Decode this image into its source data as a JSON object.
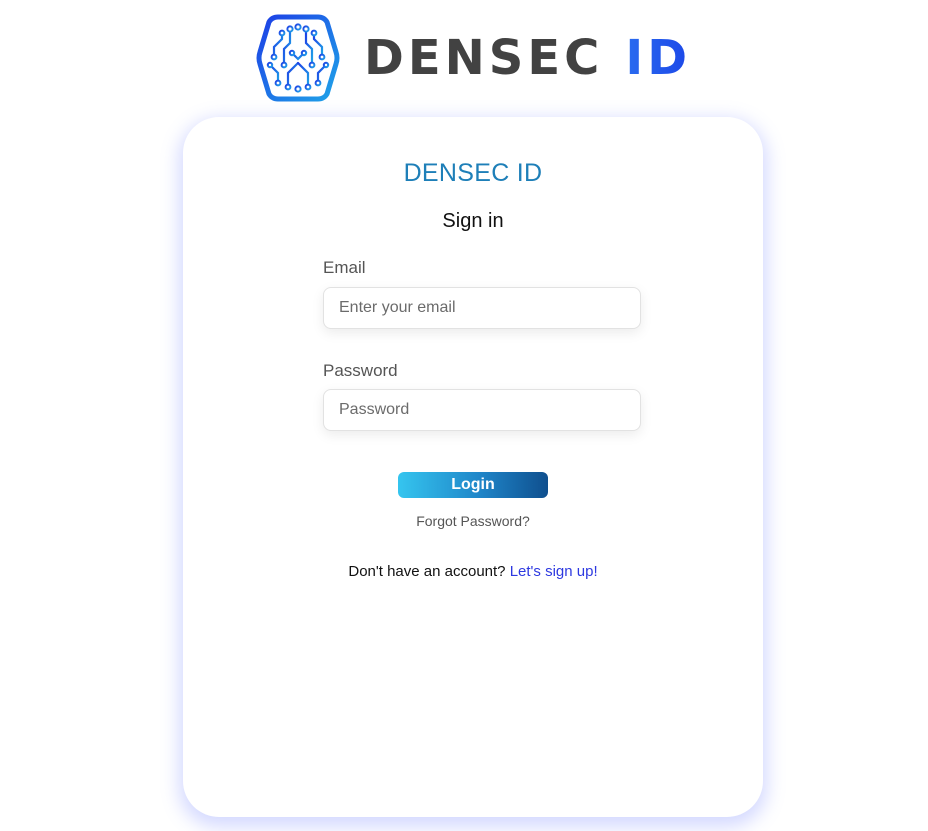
{
  "brand": {
    "logo_icon": "circuit-hexagon-logo",
    "wordmark_main": "DENSEC",
    "wordmark_accent": "ID",
    "main_color": "#424242",
    "accent_color": "#2a6cf0"
  },
  "card": {
    "title": "DENSEC ID",
    "subtitle": "Sign in",
    "title_color": "#1e7fb8"
  },
  "form": {
    "email_label": "Email",
    "email_placeholder": "Enter your email",
    "email_value": "",
    "password_label": "Password",
    "password_placeholder": "Password",
    "password_value": "",
    "login_label": "Login",
    "forgot_label": "Forgot Password?"
  },
  "signup": {
    "prompt": "Don't have an account? ",
    "link_label": "Let's sign up",
    "suffix": "!",
    "link_color": "#2d39e0"
  }
}
